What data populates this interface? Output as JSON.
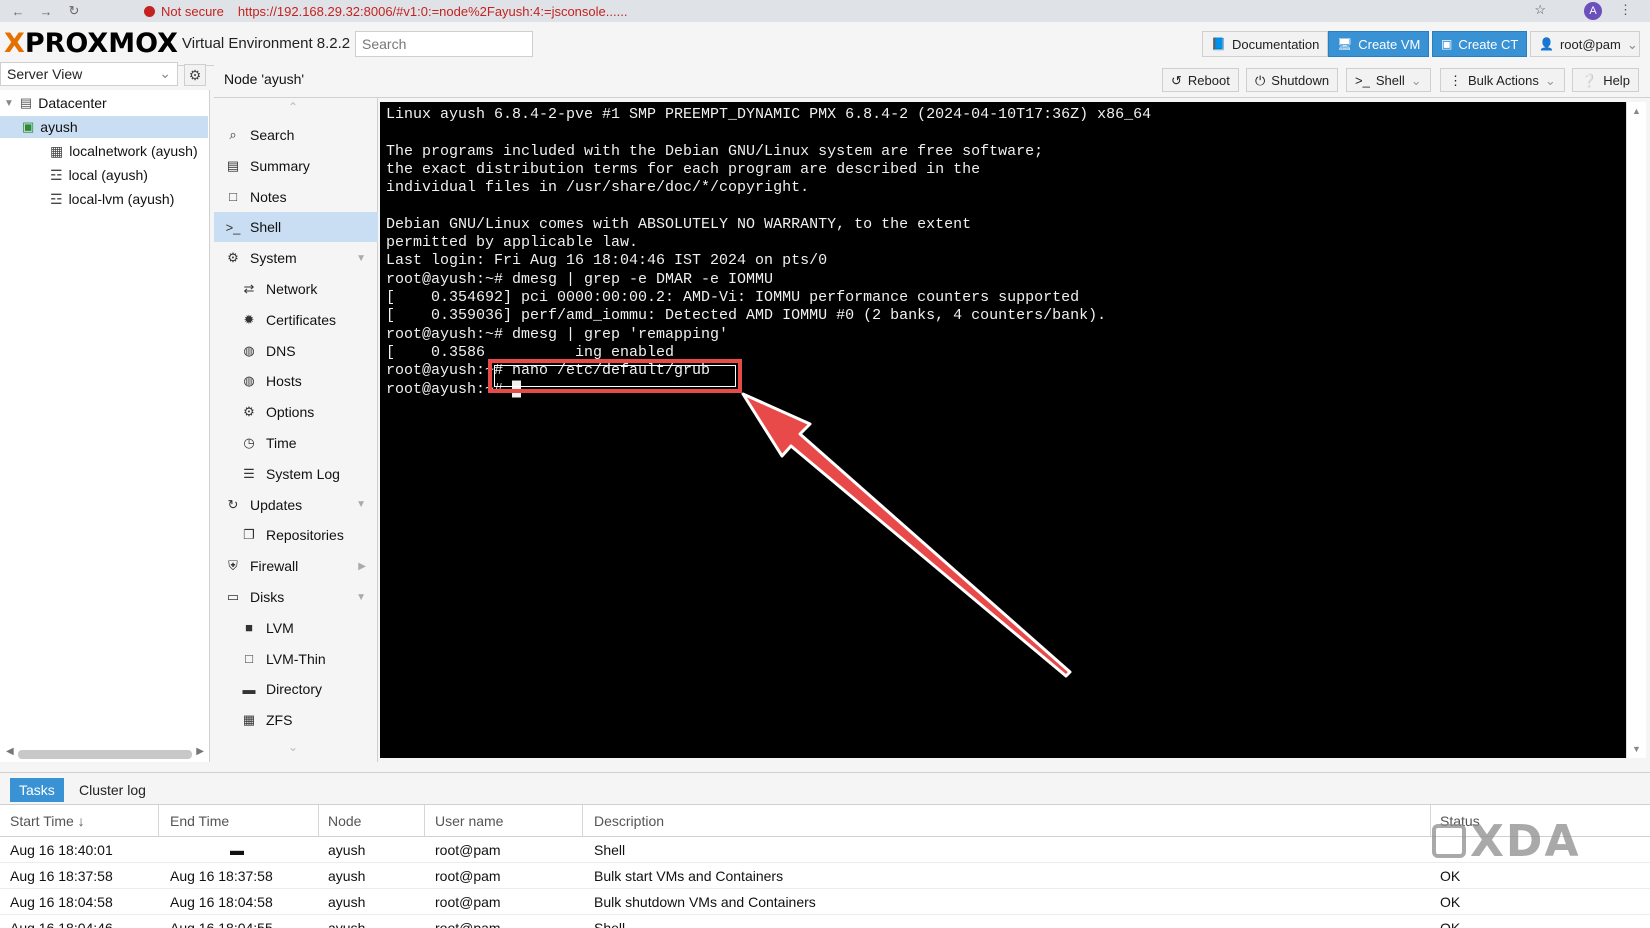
{
  "browser": {
    "security_label": "Not secure",
    "url": "https://192.168.29.32:8006/#v1:0:=node%2Fayush:4:=jsconsole......",
    "profile_initial": "A"
  },
  "header": {
    "logo_x": "X",
    "logo_text": "PROXMOX",
    "product": "Virtual Environment 8.2.2",
    "search_placeholder": "Search",
    "documentation": "Documentation",
    "create_vm": "Create VM",
    "create_ct": "Create CT",
    "user": "root@pam"
  },
  "view_selector": "Server View",
  "node_toolbar": {
    "title": "Node 'ayush'",
    "reboot": "Reboot",
    "shutdown": "Shutdown",
    "shell": "Shell",
    "bulk_actions": "Bulk Actions",
    "help": "Help"
  },
  "tree": {
    "datacenter": "Datacenter",
    "node": "ayush",
    "storages": [
      "localnetwork (ayush)",
      "local (ayush)",
      "local-lvm (ayush)"
    ]
  },
  "menu": [
    {
      "label": "Search",
      "icon": "search-icon"
    },
    {
      "label": "Summary",
      "icon": "book-icon"
    },
    {
      "label": "Notes",
      "icon": "notes-icon"
    },
    {
      "label": "Shell",
      "icon": "terminal-icon",
      "selected": true
    },
    {
      "label": "System",
      "icon": "cogs-icon",
      "expandable": true
    },
    {
      "label": "Network",
      "icon": "network-icon",
      "child": true
    },
    {
      "label": "Certificates",
      "icon": "certificate-icon",
      "child": true
    },
    {
      "label": "DNS",
      "icon": "globe-icon",
      "child": true
    },
    {
      "label": "Hosts",
      "icon": "globe-icon",
      "child": true
    },
    {
      "label": "Options",
      "icon": "gear-icon",
      "child": true
    },
    {
      "label": "Time",
      "icon": "clock-icon",
      "child": true
    },
    {
      "label": "System Log",
      "icon": "list-icon",
      "child": true
    },
    {
      "label": "Updates",
      "icon": "refresh-icon",
      "expandable": true
    },
    {
      "label": "Repositories",
      "icon": "files-icon",
      "child": true
    },
    {
      "label": "Firewall",
      "icon": "shield-icon",
      "expandable": true
    },
    {
      "label": "Disks",
      "icon": "drive-icon",
      "expandable": true
    },
    {
      "label": "LVM",
      "icon": "square-filled-icon",
      "child": true
    },
    {
      "label": "LVM-Thin",
      "icon": "square-outline-icon",
      "child": true
    },
    {
      "label": "Directory",
      "icon": "folder-icon",
      "child": true
    },
    {
      "label": "ZFS",
      "icon": "grid-icon",
      "child": true
    }
  ],
  "terminal": {
    "lines": [
      "Linux ayush 6.8.4-2-pve #1 SMP PREEMPT_DYNAMIC PMX 6.8.4-2 (2024-04-10T17:36Z) x86_64",
      "",
      "The programs included with the Debian GNU/Linux system are free software;",
      "the exact distribution terms for each program are described in the",
      "individual files in /usr/share/doc/*/copyright.",
      "",
      "Debian GNU/Linux comes with ABSOLUTELY NO WARRANTY, to the extent",
      "permitted by applicable law.",
      "Last login: Fri Aug 16 18:04:46 IST 2024 on pts/0",
      "root@ayush:~# dmesg | grep -e DMAR -e IOMMU",
      "[    0.354692] pci 0000:00:00.2: AMD-Vi: IOMMU performance counters supported",
      "[    0.359036] perf/amd_iommu: Detected AMD IOMMU #0 (2 banks, 4 counters/bank).",
      "root@ayush:~# dmesg | grep 'remapping'",
      "[    0.3586          ing enabled",
      "root@ayush:~# nano /etc/default/grub",
      "root@ayush:~# █"
    ],
    "highlight_color": "#e84a4a"
  },
  "bottom": {
    "tabs": [
      "Tasks",
      "Cluster log"
    ],
    "columns": [
      "Start Time ↓",
      "End Time",
      "Node",
      "User name",
      "Description",
      "Status"
    ],
    "rows": [
      {
        "start": "Aug 16 18:40:01",
        "end": "",
        "node": "ayush",
        "user": "root@pam",
        "desc": "Shell",
        "status": ""
      },
      {
        "start": "Aug 16 18:37:58",
        "end": "Aug 16 18:37:58",
        "node": "ayush",
        "user": "root@pam",
        "desc": "Bulk start VMs and Containers",
        "status": "OK"
      },
      {
        "start": "Aug 16 18:04:58",
        "end": "Aug 16 18:04:58",
        "node": "ayush",
        "user": "root@pam",
        "desc": "Bulk shutdown VMs and Containers",
        "status": "OK"
      },
      {
        "start": "Aug 16 18:04:46",
        "end": "Aug 16 18:04:55",
        "node": "ayush",
        "user": "root@pam",
        "desc": "Shell",
        "status": "OK"
      }
    ]
  },
  "watermark": "XDA",
  "colors": {
    "accent": "#3892d4",
    "logo_orange": "#e57000",
    "selection": "#c9def2"
  }
}
